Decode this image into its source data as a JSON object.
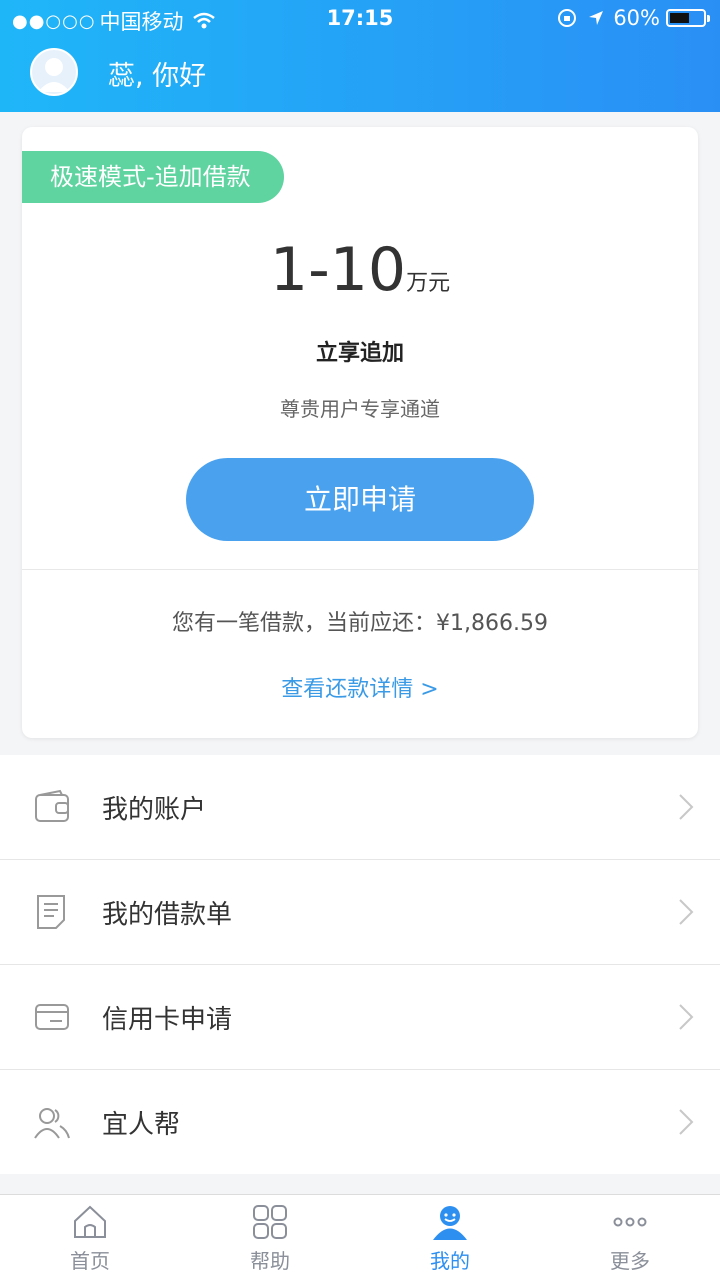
{
  "status_bar": {
    "carrier": "中国移动",
    "time": "17:15",
    "battery": "60%",
    "battery_level": 0.6
  },
  "header": {
    "greeting": "蕊, 你好"
  },
  "card": {
    "mode_tag": "极速模式-追加借款",
    "amount_range": "1-10",
    "amount_unit": "万元",
    "highlight": "立享追加",
    "subtitle": "尊贵用户专享通道",
    "apply_button": "立即申请",
    "loan_info": "您有一笔借款，当前应还：¥1,866.59",
    "repay_link": "查看还款详情 >"
  },
  "menu": {
    "items": [
      {
        "label": "我的账户",
        "icon": "wallet-icon"
      },
      {
        "label": "我的借款单",
        "icon": "document-icon"
      },
      {
        "label": "信用卡申请",
        "icon": "credit-card-icon"
      },
      {
        "label": "宜人帮",
        "icon": "users-icon"
      }
    ]
  },
  "tabbar": {
    "tabs": [
      {
        "label": "首页",
        "icon": "home-icon"
      },
      {
        "label": "帮助",
        "icon": "grid-icon"
      },
      {
        "label": "我的",
        "icon": "user-icon",
        "active": true
      },
      {
        "label": "更多",
        "icon": "more-icon"
      }
    ]
  },
  "colors": {
    "header_start": "#1fb6f8",
    "header_end": "#2a8ff5",
    "tag": "#5fd3a0",
    "button": "#4aa2ef",
    "link": "#3a9ae6",
    "tab_active": "#2d8ff0"
  }
}
